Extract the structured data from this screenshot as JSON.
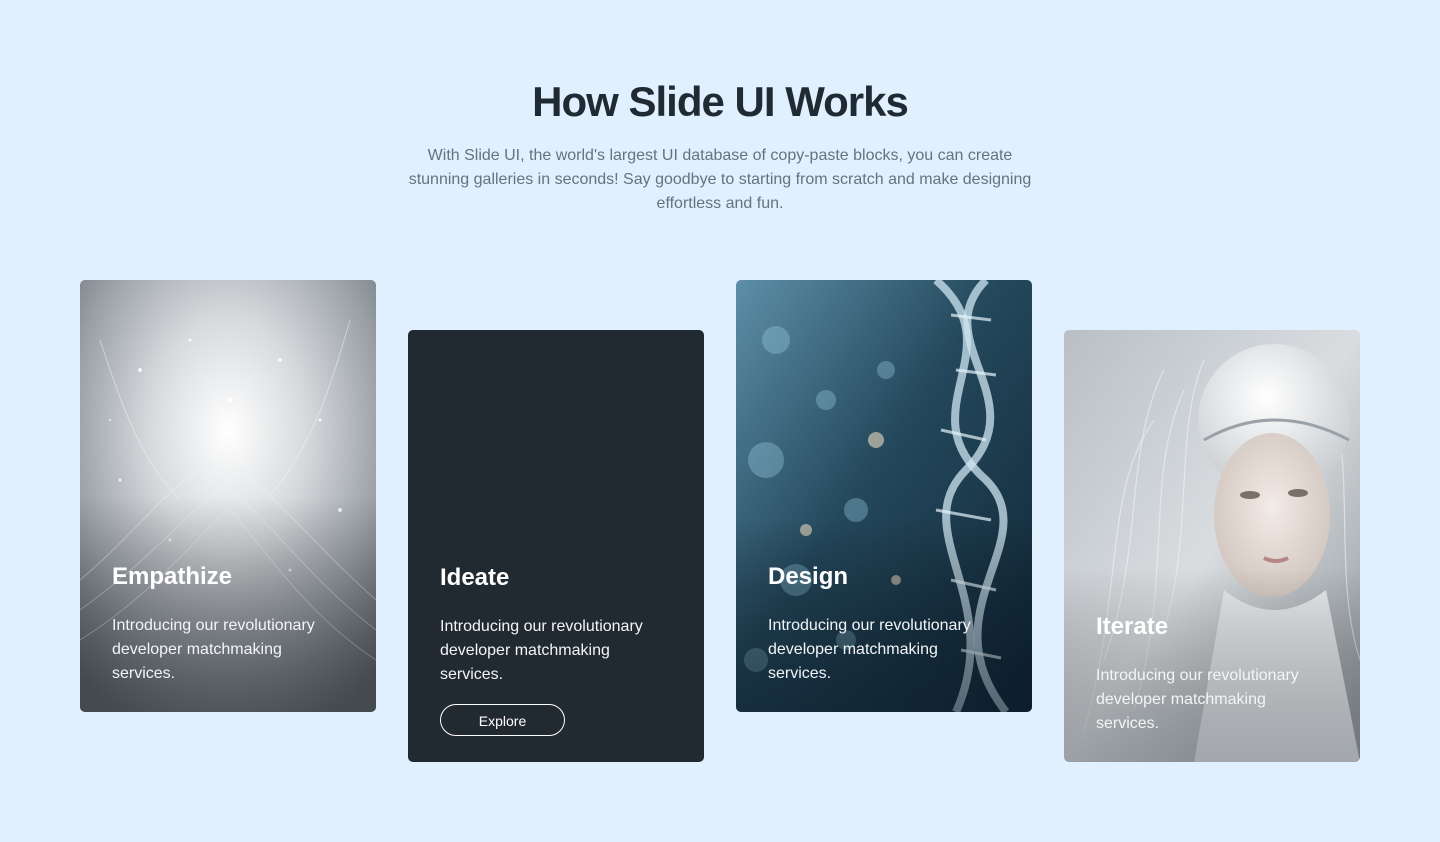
{
  "header": {
    "title": "How Slide UI Works",
    "subtitle": "With Slide UI, the world's largest UI database of copy-paste blocks, you can create stunning galleries in seconds! Say goodbye to starting from scratch and make designing effortless and fun."
  },
  "cards": [
    {
      "title": "Empathize",
      "text": "Introducing our revolutionary developer matchmaking services.",
      "image": "abstract-silver-tunnel"
    },
    {
      "title": "Ideate",
      "text": "Introducing our revolutionary developer matchmaking services.",
      "button": "Explore",
      "background": "#222a31"
    },
    {
      "title": "Design",
      "text": "Introducing our revolutionary developer matchmaking services.",
      "image": "glass-dna-helix"
    },
    {
      "title": "Iterate",
      "text": "Introducing our revolutionary developer matchmaking services.",
      "image": "white-android-portrait"
    }
  ],
  "colors": {
    "page_background": "#e1f0fe",
    "title": "#1f2a33",
    "subtitle": "#66737e",
    "dark_card": "#222a31"
  }
}
